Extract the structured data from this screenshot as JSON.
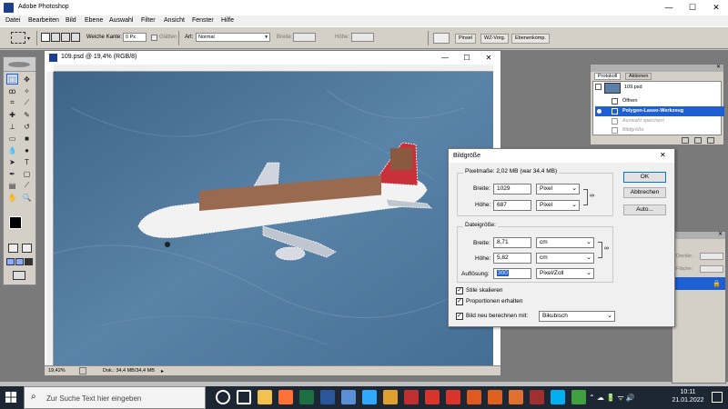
{
  "app": {
    "title": "Adobe Photoshop",
    "window_controls": {
      "minimize": "—",
      "maximize": "☐",
      "close": "✕"
    }
  },
  "menu": [
    "Datei",
    "Bearbeiten",
    "Bild",
    "Ebene",
    "Auswahl",
    "Filter",
    "Ansicht",
    "Fenster",
    "Hilfe"
  ],
  "options_bar": {
    "feather_label": "Weiche Kante:",
    "feather_value": "0 Px",
    "antialias_label": "Glätten",
    "style_label": "Art:",
    "style_value": "Normal",
    "width_label": "Breite:",
    "height_label": "Höhe:"
  },
  "palette_well": {
    "tabs": [
      "Pinsel",
      "WZ-Vorg.",
      "Ebenenkomp."
    ]
  },
  "document": {
    "title": "109.psd @ 19,4% (RGB/8)",
    "zoom": "19,42%",
    "doc_info": "Dok.: 34,4 MB/34,4 MB",
    "window_controls": {
      "minimize": "—",
      "maximize": "☐",
      "close": "✕"
    }
  },
  "history_palette": {
    "tabs": [
      "Protokoll",
      "Aktionen"
    ],
    "snapshot": "109.psd",
    "items": [
      {
        "label": "Öffnen",
        "state": "normal"
      },
      {
        "label": "Polygon-Lasso-Werkzeug",
        "state": "selected"
      },
      {
        "label": "Auswahl speichern",
        "state": "dimmed"
      },
      {
        "label": "",
        "state": "dimmed"
      },
      {
        "label": "Bildgröße",
        "state": "dimmed"
      }
    ]
  },
  "layers_palette": {
    "opacity_label": "Deckkr.:",
    "fill_label": "Fläche:"
  },
  "dialog": {
    "title": "Bildgröße",
    "close": "✕",
    "pixel_group": {
      "label": "Pixelmaße: 2,02 MB (war 34,4 MB)",
      "width_label": "Breite:",
      "width_value": "1029",
      "width_unit": "Pixel",
      "height_label": "Höhe:",
      "height_value": "687",
      "height_unit": "Pixel"
    },
    "doc_group": {
      "label": "Dateigröße:",
      "width_label": "Breite:",
      "width_value": "8,71",
      "width_unit": "cm",
      "height_label": "Höhe:",
      "height_value": "5,82",
      "height_unit": "cm",
      "res_label": "Auflösung:",
      "res_value": "300",
      "res_unit": "Pixel/Zoll"
    },
    "checkboxes": [
      {
        "label": "Stile skalieren",
        "checked": true
      },
      {
        "label": "Proportionen erhalten",
        "checked": true
      },
      {
        "label": "Bild neu berechnen mit:",
        "checked": true
      }
    ],
    "resample_value": "Bikubisch",
    "buttons": {
      "ok": "OK",
      "cancel": "Abbrechen",
      "auto": "Auto..."
    }
  },
  "taskbar": {
    "search_placeholder": "Zur Suche Text hier eingeben",
    "time": "10:11",
    "date": "21.01.2022",
    "icons": [
      {
        "name": "cortana-icon",
        "color": "#ffffff"
      },
      {
        "name": "task-view-icon",
        "color": "#ffffff"
      },
      {
        "name": "file-explorer-icon",
        "color": "#f2c14e"
      },
      {
        "name": "firefox-icon",
        "color": "#ff7139"
      },
      {
        "name": "excel-icon",
        "color": "#1d6f42"
      },
      {
        "name": "word-icon",
        "color": "#2b579a"
      },
      {
        "name": "app-icon-1",
        "color": "#5a8fd6"
      },
      {
        "name": "photoshop-icon",
        "color": "#31a8ff"
      },
      {
        "name": "app-icon-2",
        "color": "#e0a030"
      },
      {
        "name": "app-icon-3",
        "color": "#c03030"
      },
      {
        "name": "acrobat-icon",
        "color": "#d9342b"
      },
      {
        "name": "pdf-icon",
        "color": "#d9342b"
      },
      {
        "name": "app-icon-4",
        "color": "#e05a20"
      },
      {
        "name": "app-icon-5",
        "color": "#e06020"
      },
      {
        "name": "app-icon-6",
        "color": "#e07030"
      },
      {
        "name": "app-icon-7",
        "color": "#a03030"
      },
      {
        "name": "skype-icon",
        "color": "#00aff0"
      },
      {
        "name": "app-icon-8",
        "color": "#40a040"
      }
    ]
  },
  "colors": {
    "accent_selected": "#1e5fd4",
    "canvas_bg": "#4a6f94",
    "taskbar_bg": "#1c2733"
  }
}
